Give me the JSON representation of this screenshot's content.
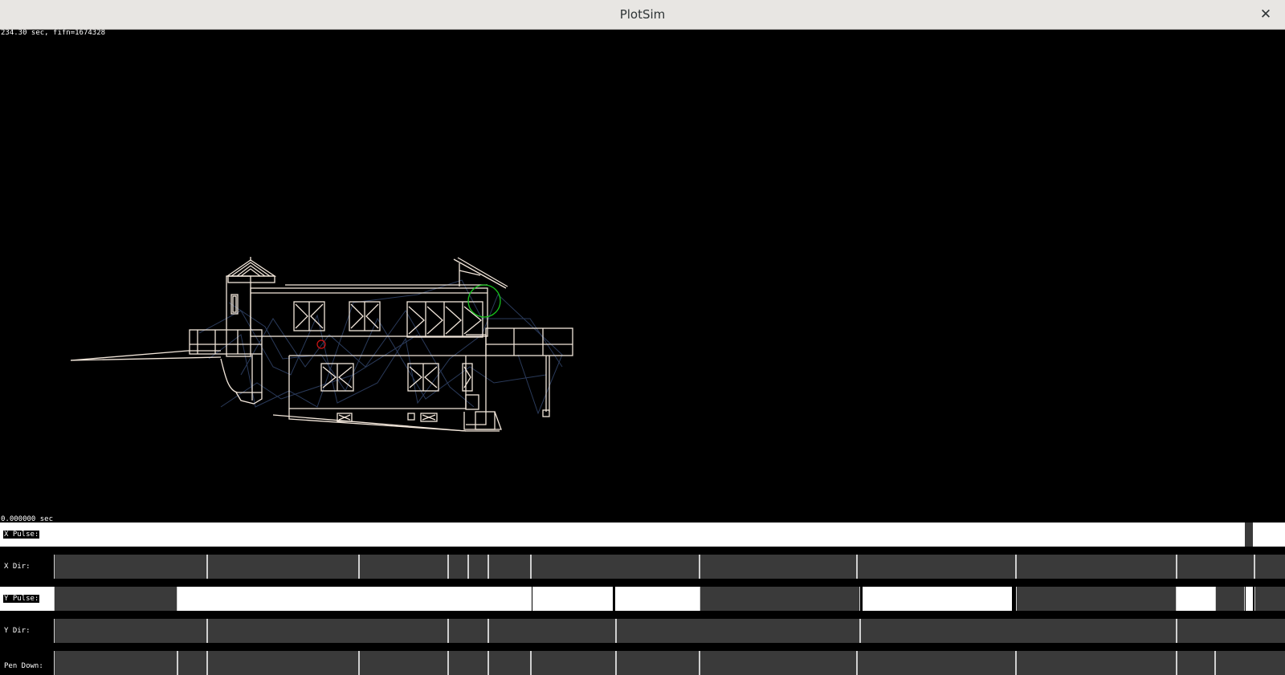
{
  "window": {
    "title": "PlotSim",
    "close_icon": "close-icon"
  },
  "status_text": "234.30 sec, fifn=1674328",
  "time_label": "0.000000 sec",
  "drawing": {
    "line_color": "#f2e6da",
    "travel_color": "#2a3a5a",
    "pen_marker_color": "#16c21c",
    "origin_marker_color": "#d11515"
  },
  "tracks": [
    {
      "id": "x-pulse",
      "label": "X Pulse:"
    },
    {
      "id": "x-dir",
      "label": "X Dir:"
    },
    {
      "id": "y-pulse",
      "label": "Y Pulse:"
    },
    {
      "id": "y-dir",
      "label": "Y Dir:"
    },
    {
      "id": "pen-down",
      "label": "Pen Down:"
    }
  ]
}
